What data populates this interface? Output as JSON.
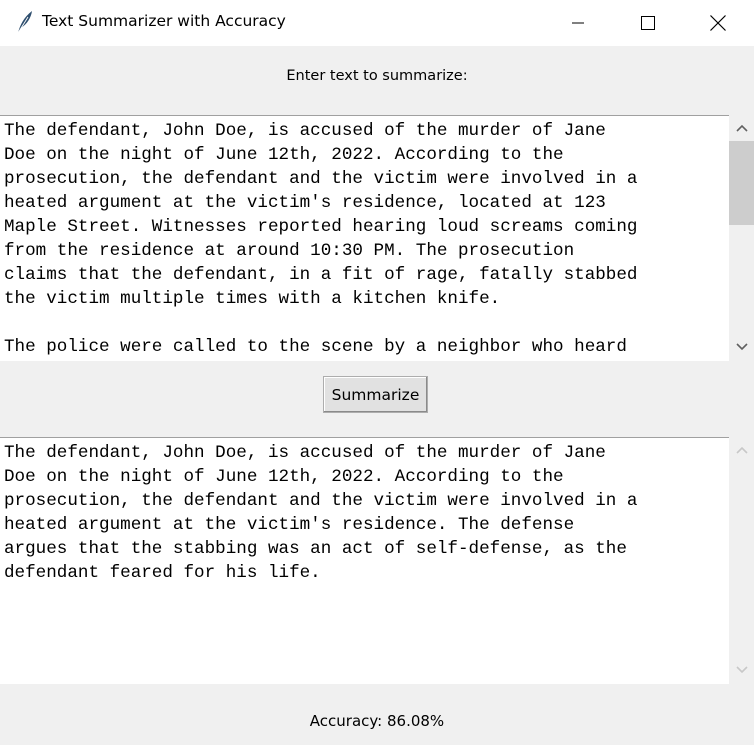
{
  "window": {
    "title": "Text Summarizer with Accuracy",
    "icons": [
      "feather-icon",
      "minimize-icon",
      "maximize-icon",
      "close-icon"
    ]
  },
  "input": {
    "label": "Enter text to summarize:",
    "text": "The defendant, John Doe, is accused of the murder of Jane\nDoe on the night of June 12th, 2022. According to the\nprosecution, the defendant and the victim were involved in a\nheated argument at the victim's residence, located at 123\nMaple Street. Witnesses reported hearing loud screams coming\nfrom the residence at around 10:30 PM. The prosecution\nclaims that the defendant, in a fit of rage, fatally stabbed\nthe victim multiple times with a kitchen knife.\n\nThe police were called to the scene by a neighbor who heard"
  },
  "actions": {
    "summarize_label": "Summarize"
  },
  "output": {
    "text": "The defendant, John Doe, is accused of the murder of Jane\nDoe on the night of June 12th, 2022. According to the\nprosecution, the defendant and the victim were involved in a\nheated argument at the victim's residence. The defense\nargues that the stabbing was an act of self-defense, as the\ndefendant feared for his life."
  },
  "status": {
    "accuracy": "Accuracy: 86.08%"
  }
}
